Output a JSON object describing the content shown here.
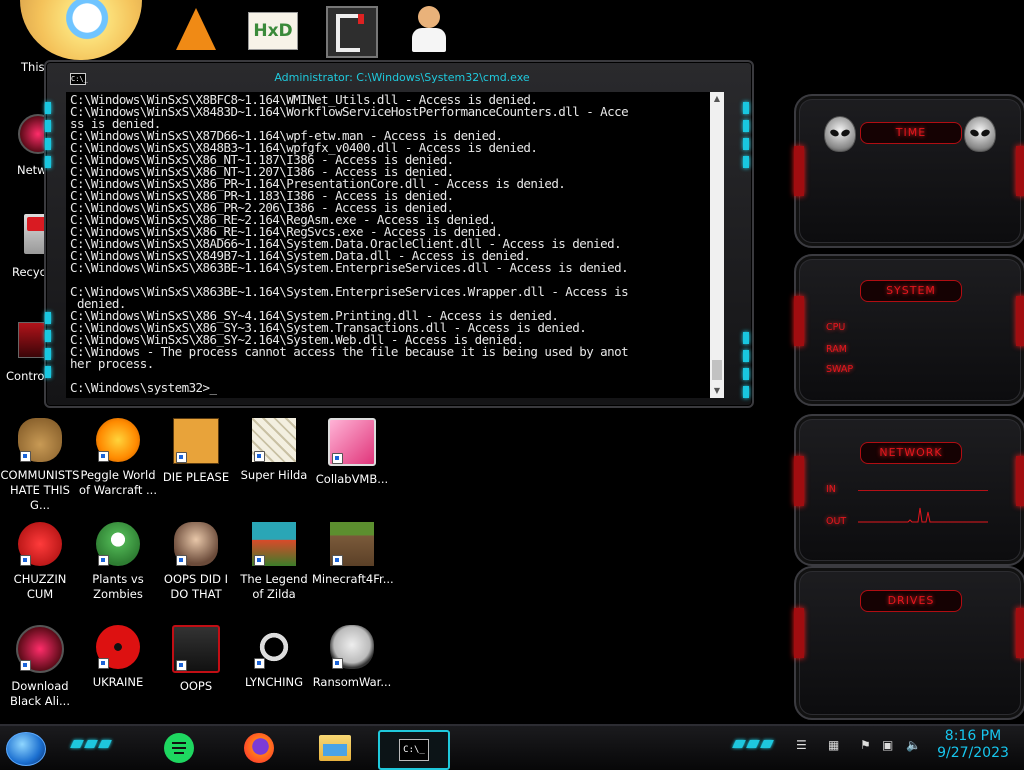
{
  "desktop": {
    "partial_labels": {
      "this_pc": "This PC",
      "network": "Netwo",
      "recycle": "Recycle",
      "control": "Control"
    },
    "icons": [
      {
        "label": "COMMUNISTS HATE THIS G...",
        "icon": "money-bag-icon"
      },
      {
        "label": "Peggle World of Warcraft ...",
        "icon": "peggle-icon"
      },
      {
        "label": "DIE PLEASE",
        "icon": "de-icon"
      },
      {
        "label": "Super Hilda",
        "icon": "pixel-hilda-icon"
      },
      {
        "label": "CollabVMB...",
        "icon": "monitor-icon"
      },
      {
        "label": "CHUZZIN CUM",
        "icon": "chuzzle-icon"
      },
      {
        "label": "Plants vs Zombies",
        "icon": "plant-icon"
      },
      {
        "label": "OOPS DID I DO THAT",
        "icon": "portrait-icon"
      },
      {
        "label": "The Legend of Zilda",
        "icon": "zelda-icon"
      },
      {
        "label": "Minecraft4Fr...",
        "icon": "grass-block-icon"
      },
      {
        "label": "Download Black Ali...",
        "icon": "alien-globe-icon"
      },
      {
        "label": "UKRAINE",
        "icon": "radiation-icon"
      },
      {
        "label": "OOPS",
        "icon": "alien-monitor-icon"
      },
      {
        "label": "LYNCHING",
        "icon": "chainlink-icon"
      },
      {
        "label": "RansomWar...",
        "icon": "skull-icon"
      }
    ]
  },
  "cmd": {
    "title": "Administrator: C:\\Windows\\System32\\cmd.exe",
    "sysicon": "C:\\_",
    "lines": "C:\\Windows\\WinSxS\\X8BFC8~1.164\\WMINet_Utils.dll - Access is denied.\nC:\\Windows\\WinSxS\\X8483D~1.164\\WorkflowServiceHostPerformanceCounters.dll - Acce\nss is denied.\nC:\\Windows\\WinSxS\\X87D66~1.164\\wpf-etw.man - Access is denied.\nC:\\Windows\\WinSxS\\X848B3~1.164\\wpfgfx_v0400.dll - Access is denied.\nC:\\Windows\\WinSxS\\X86_NT~1.187\\I386 - Access is denied.\nC:\\Windows\\WinSxS\\X86_NT~1.207\\I386 - Access is denied.\nC:\\Windows\\WinSxS\\X86_PR~1.164\\PresentationCore.dll - Access is denied.\nC:\\Windows\\WinSxS\\X86_PR~1.183\\I386 - Access is denied.\nC:\\Windows\\WinSxS\\X86_PR~2.206\\I386 - Access is denied.\nC:\\Windows\\WinSxS\\X86_RE~2.164\\RegAsm.exe - Access is denied.\nC:\\Windows\\WinSxS\\X86_RE~1.164\\RegSvcs.exe - Access is denied.\nC:\\Windows\\WinSxS\\X8AD66~1.164\\System.Data.OracleClient.dll - Access is denied.\nC:\\Windows\\WinSxS\\X849B7~1.164\\System.Data.dll - Access is denied.\nC:\\Windows\\WinSxS\\X863BE~1.164\\System.EnterpriseServices.dll - Access is denied.\n\nC:\\Windows\\WinSxS\\X863BE~1.164\\System.EnterpriseServices.Wrapper.dll - Access is\n denied.\nC:\\Windows\\WinSxS\\X86_SY~4.164\\System.Printing.dll - Access is denied.\nC:\\Windows\\WinSxS\\X86_SY~3.164\\System.Transactions.dll - Access is denied.\nC:\\Windows\\WinSxS\\X86_SY~2.164\\System.Web.dll - Access is denied.\nC:\\Windows - The process cannot access the file because it is being used by anot\nher process.\n\nC:\\Windows\\system32>_"
  },
  "gadgets": {
    "time": {
      "title": "TIME"
    },
    "system": {
      "title": "SYSTEM",
      "labels": [
        "CPU",
        "RAM",
        "SWAP"
      ]
    },
    "network": {
      "title": "NETWORK",
      "in_label": "IN",
      "out_label": "OUT"
    },
    "drives": {
      "title": "DRIVES"
    }
  },
  "taskbar": {
    "cmd_label": "C:\\_",
    "clock_time": "8:16 PM",
    "clock_date": "9/27/2023"
  },
  "colors": {
    "accent": "#1fc9dc",
    "red": "#e3161d"
  }
}
